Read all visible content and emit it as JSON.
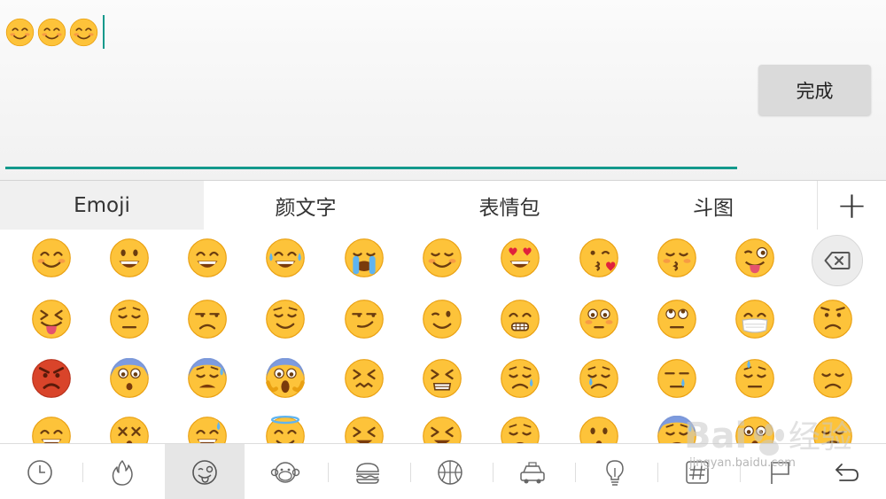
{
  "input": {
    "typed_text": "😊😊😊",
    "typed_emoji": [
      "smiling-face",
      "smiling-face",
      "smiling-face"
    ]
  },
  "done_button": {
    "label": "完成"
  },
  "tabs": [
    {
      "label": "Emoji",
      "active": true
    },
    {
      "label": "颜文字",
      "active": false
    },
    {
      "label": "表情包",
      "active": false
    },
    {
      "label": "斗图",
      "active": false
    }
  ],
  "add_tab": {
    "label": "+"
  },
  "emoji_rows": [
    [
      "smiling-eyes",
      "grinning",
      "grinning-big-eyes",
      "tears-of-joy",
      "loudly-crying",
      "relaxed-blush",
      "heart-eyes",
      "kissing-heart",
      "kissing-closed-eyes",
      "winking-tongue"
    ],
    [
      "squinting-tongue",
      "pensive",
      "unamused",
      "relieved",
      "smirking",
      "winking",
      "grimacing",
      "flushed",
      "rolling-eyes",
      "medical-mask",
      "angry"
    ],
    [
      "pouting-red",
      "anxious",
      "anxious-sweat",
      "screaming",
      "confounded",
      "persevering",
      "disappointed-relieved",
      "crying",
      "sleepy",
      "downcast-sweat",
      "disappointed"
    ],
    [
      "grinning-smile",
      "dizzy",
      "grinning-sweat",
      "halo",
      "tired-squint",
      "tired-squint",
      "weary",
      "hushed",
      "cold-sweat",
      "astonished",
      "triumph"
    ]
  ],
  "backspace": {
    "icon": "backspace-icon"
  },
  "categories": [
    {
      "name": "recent",
      "icon": "clock-icon"
    },
    {
      "name": "hot",
      "icon": "flame-icon"
    },
    {
      "name": "faces",
      "icon": "wink-face-icon",
      "active": true
    },
    {
      "name": "animals",
      "icon": "monkey-icon"
    },
    {
      "name": "food",
      "icon": "burger-icon"
    },
    {
      "name": "sports",
      "icon": "basketball-icon"
    },
    {
      "name": "travel",
      "icon": "car-icon"
    },
    {
      "name": "objects",
      "icon": "bulb-icon"
    },
    {
      "name": "symbols",
      "icon": "hash-icon"
    },
    {
      "name": "flags",
      "icon": "flag-icon"
    },
    {
      "name": "back",
      "icon": "return-icon"
    }
  ],
  "watermark": {
    "text": "Bai 经验",
    "subtext": "jingyan.baidu.com"
  },
  "colors": {
    "accent": "#13998c",
    "face": "#fdc33a",
    "face_edge": "#e9a012",
    "red_face": "#d9442a"
  }
}
